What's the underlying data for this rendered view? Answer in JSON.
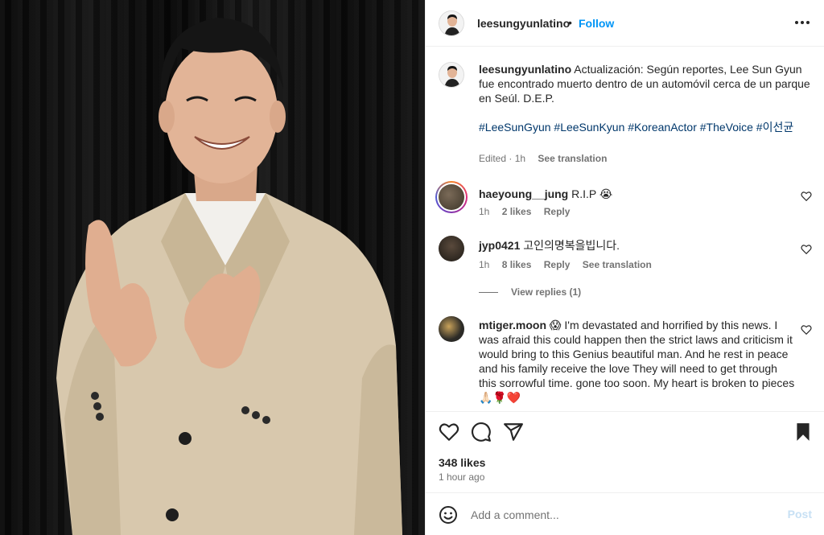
{
  "header": {
    "username": "leesungyunlatino",
    "separator": "•",
    "follow_label": "Follow"
  },
  "caption": {
    "username": "leesungyunlatino",
    "text": "Actualización: Según reportes, Lee Sun Gyun fue encontrado muerto dentro de un automóvil cerca de un parque en Seúl. D.E.P.",
    "hashtags": "#LeeSunGyun #LeeSunKyun #KoreanActor #TheVoice #이선균",
    "edited": "Edited · 1h",
    "see_translation": "See translation"
  },
  "comments": [
    {
      "username": "haeyoung__jung",
      "text": "R.I.P 😭",
      "time": "1h",
      "likes": "2 likes",
      "reply": "Reply"
    },
    {
      "username": "jyp0421",
      "text": "고인의명복을빕니다.",
      "time": "1h",
      "likes": "8 likes",
      "reply": "Reply",
      "see_translation": "See translation",
      "view_replies": "View replies (1)"
    },
    {
      "username": "mtiger.moon",
      "text": "😱 I'm devastated and horrified by this news. I was afraid this could happen then the strict laws and criticism it would bring to this Genius beautiful man. And he rest in peace and his family receive the love They will need to get through this sorrowful time. gone too soon. My heart is broken to pieces 🙏🏻🌹❤️"
    }
  ],
  "post_stats": {
    "likes": "348 likes",
    "time_ago": "1 hour ago"
  },
  "comment_box": {
    "placeholder": "Add a comment...",
    "post_label": "Post"
  },
  "icons": {
    "more": "more-horizontal-icon",
    "like": "heart-icon",
    "comment": "comment-icon",
    "share": "share-icon",
    "save": "bookmark-icon",
    "emoji": "emoji-icon"
  },
  "colors": {
    "link": "#0095f6",
    "hashtag": "#00376b",
    "muted": "#737373",
    "jacket": "#d8c8ad",
    "background": "#0d0d0d"
  }
}
